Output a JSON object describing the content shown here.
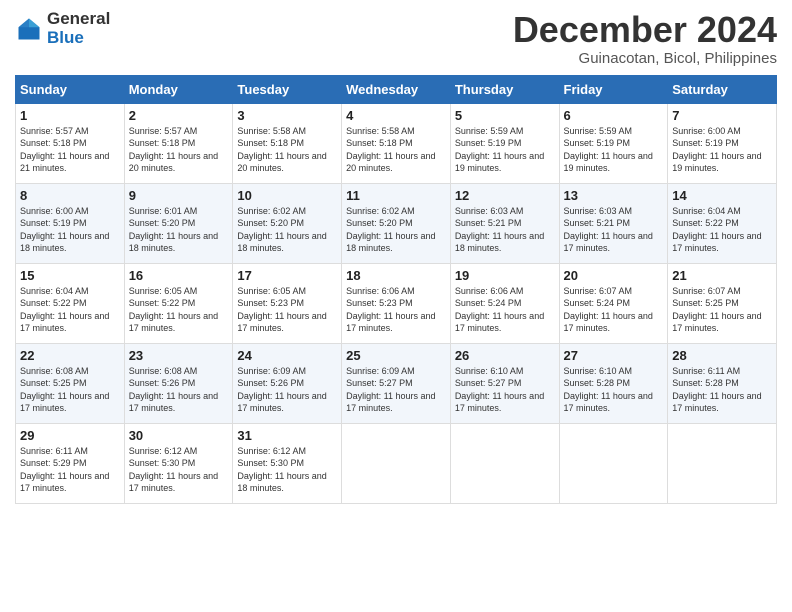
{
  "logo": {
    "general": "General",
    "blue": "Blue"
  },
  "header": {
    "month": "December 2024",
    "location": "Guinacotan, Bicol, Philippines"
  },
  "days_of_week": [
    "Sunday",
    "Monday",
    "Tuesday",
    "Wednesday",
    "Thursday",
    "Friday",
    "Saturday"
  ],
  "weeks": [
    [
      {
        "day": "1",
        "sunrise": "Sunrise: 5:57 AM",
        "sunset": "Sunset: 5:18 PM",
        "daylight": "Daylight: 11 hours and 21 minutes."
      },
      {
        "day": "2",
        "sunrise": "Sunrise: 5:57 AM",
        "sunset": "Sunset: 5:18 PM",
        "daylight": "Daylight: 11 hours and 20 minutes."
      },
      {
        "day": "3",
        "sunrise": "Sunrise: 5:58 AM",
        "sunset": "Sunset: 5:18 PM",
        "daylight": "Daylight: 11 hours and 20 minutes."
      },
      {
        "day": "4",
        "sunrise": "Sunrise: 5:58 AM",
        "sunset": "Sunset: 5:18 PM",
        "daylight": "Daylight: 11 hours and 20 minutes."
      },
      {
        "day": "5",
        "sunrise": "Sunrise: 5:59 AM",
        "sunset": "Sunset: 5:19 PM",
        "daylight": "Daylight: 11 hours and 19 minutes."
      },
      {
        "day": "6",
        "sunrise": "Sunrise: 5:59 AM",
        "sunset": "Sunset: 5:19 PM",
        "daylight": "Daylight: 11 hours and 19 minutes."
      },
      {
        "day": "7",
        "sunrise": "Sunrise: 6:00 AM",
        "sunset": "Sunset: 5:19 PM",
        "daylight": "Daylight: 11 hours and 19 minutes."
      }
    ],
    [
      {
        "day": "8",
        "sunrise": "Sunrise: 6:00 AM",
        "sunset": "Sunset: 5:19 PM",
        "daylight": "Daylight: 11 hours and 18 minutes."
      },
      {
        "day": "9",
        "sunrise": "Sunrise: 6:01 AM",
        "sunset": "Sunset: 5:20 PM",
        "daylight": "Daylight: 11 hours and 18 minutes."
      },
      {
        "day": "10",
        "sunrise": "Sunrise: 6:02 AM",
        "sunset": "Sunset: 5:20 PM",
        "daylight": "Daylight: 11 hours and 18 minutes."
      },
      {
        "day": "11",
        "sunrise": "Sunrise: 6:02 AM",
        "sunset": "Sunset: 5:20 PM",
        "daylight": "Daylight: 11 hours and 18 minutes."
      },
      {
        "day": "12",
        "sunrise": "Sunrise: 6:03 AM",
        "sunset": "Sunset: 5:21 PM",
        "daylight": "Daylight: 11 hours and 18 minutes."
      },
      {
        "day": "13",
        "sunrise": "Sunrise: 6:03 AM",
        "sunset": "Sunset: 5:21 PM",
        "daylight": "Daylight: 11 hours and 17 minutes."
      },
      {
        "day": "14",
        "sunrise": "Sunrise: 6:04 AM",
        "sunset": "Sunset: 5:22 PM",
        "daylight": "Daylight: 11 hours and 17 minutes."
      }
    ],
    [
      {
        "day": "15",
        "sunrise": "Sunrise: 6:04 AM",
        "sunset": "Sunset: 5:22 PM",
        "daylight": "Daylight: 11 hours and 17 minutes."
      },
      {
        "day": "16",
        "sunrise": "Sunrise: 6:05 AM",
        "sunset": "Sunset: 5:22 PM",
        "daylight": "Daylight: 11 hours and 17 minutes."
      },
      {
        "day": "17",
        "sunrise": "Sunrise: 6:05 AM",
        "sunset": "Sunset: 5:23 PM",
        "daylight": "Daylight: 11 hours and 17 minutes."
      },
      {
        "day": "18",
        "sunrise": "Sunrise: 6:06 AM",
        "sunset": "Sunset: 5:23 PM",
        "daylight": "Daylight: 11 hours and 17 minutes."
      },
      {
        "day": "19",
        "sunrise": "Sunrise: 6:06 AM",
        "sunset": "Sunset: 5:24 PM",
        "daylight": "Daylight: 11 hours and 17 minutes."
      },
      {
        "day": "20",
        "sunrise": "Sunrise: 6:07 AM",
        "sunset": "Sunset: 5:24 PM",
        "daylight": "Daylight: 11 hours and 17 minutes."
      },
      {
        "day": "21",
        "sunrise": "Sunrise: 6:07 AM",
        "sunset": "Sunset: 5:25 PM",
        "daylight": "Daylight: 11 hours and 17 minutes."
      }
    ],
    [
      {
        "day": "22",
        "sunrise": "Sunrise: 6:08 AM",
        "sunset": "Sunset: 5:25 PM",
        "daylight": "Daylight: 11 hours and 17 minutes."
      },
      {
        "day": "23",
        "sunrise": "Sunrise: 6:08 AM",
        "sunset": "Sunset: 5:26 PM",
        "daylight": "Daylight: 11 hours and 17 minutes."
      },
      {
        "day": "24",
        "sunrise": "Sunrise: 6:09 AM",
        "sunset": "Sunset: 5:26 PM",
        "daylight": "Daylight: 11 hours and 17 minutes."
      },
      {
        "day": "25",
        "sunrise": "Sunrise: 6:09 AM",
        "sunset": "Sunset: 5:27 PM",
        "daylight": "Daylight: 11 hours and 17 minutes."
      },
      {
        "day": "26",
        "sunrise": "Sunrise: 6:10 AM",
        "sunset": "Sunset: 5:27 PM",
        "daylight": "Daylight: 11 hours and 17 minutes."
      },
      {
        "day": "27",
        "sunrise": "Sunrise: 6:10 AM",
        "sunset": "Sunset: 5:28 PM",
        "daylight": "Daylight: 11 hours and 17 minutes."
      },
      {
        "day": "28",
        "sunrise": "Sunrise: 6:11 AM",
        "sunset": "Sunset: 5:28 PM",
        "daylight": "Daylight: 11 hours and 17 minutes."
      }
    ],
    [
      {
        "day": "29",
        "sunrise": "Sunrise: 6:11 AM",
        "sunset": "Sunset: 5:29 PM",
        "daylight": "Daylight: 11 hours and 17 minutes."
      },
      {
        "day": "30",
        "sunrise": "Sunrise: 6:12 AM",
        "sunset": "Sunset: 5:30 PM",
        "daylight": "Daylight: 11 hours and 17 minutes."
      },
      {
        "day": "31",
        "sunrise": "Sunrise: 6:12 AM",
        "sunset": "Sunset: 5:30 PM",
        "daylight": "Daylight: 11 hours and 18 minutes."
      },
      {
        "day": "",
        "sunrise": "",
        "sunset": "",
        "daylight": ""
      },
      {
        "day": "",
        "sunrise": "",
        "sunset": "",
        "daylight": ""
      },
      {
        "day": "",
        "sunrise": "",
        "sunset": "",
        "daylight": ""
      },
      {
        "day": "",
        "sunrise": "",
        "sunset": "",
        "daylight": ""
      }
    ]
  ]
}
